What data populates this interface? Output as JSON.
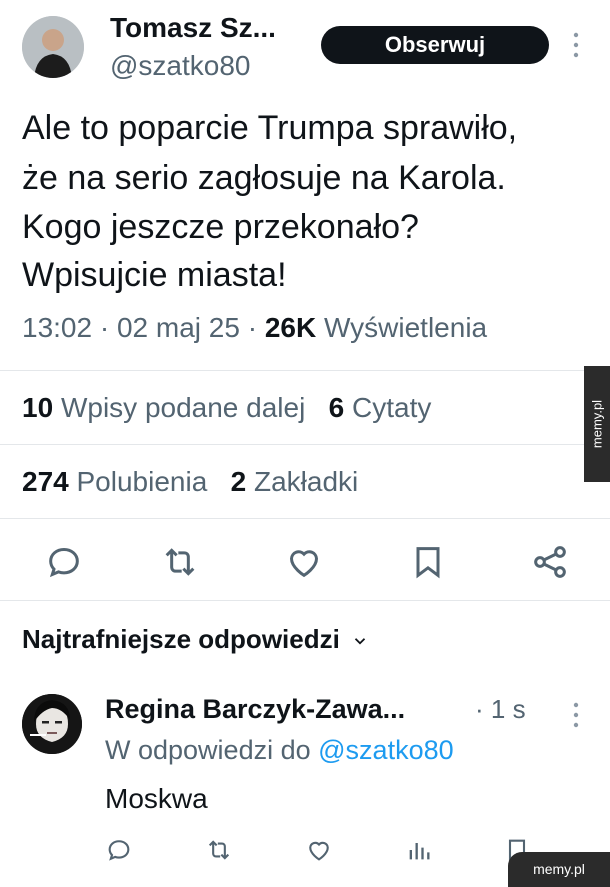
{
  "author": {
    "name": "Tomasz Sz...",
    "handle": "@szatko80",
    "follow_label": "Obserwuj"
  },
  "tweet": {
    "lines": [
      "Ale to poparcie Trumpa sprawiło,",
      "że na serio zagłosuje na Karola.",
      "Kogo jeszcze przekonało?",
      "Wpisujcie miasta!"
    ],
    "time": "13:02",
    "date": "02 maj 25",
    "views_count": "26K",
    "views_label": "Wyświetlenia"
  },
  "stats": {
    "reposts_count": "10",
    "reposts_label": "Wpisy podane dalej",
    "quotes_count": "6",
    "quotes_label": "Cytaty",
    "likes_count": "274",
    "likes_label": "Polubienia",
    "bookmarks_count": "2",
    "bookmarks_label": "Zakładki"
  },
  "replies": {
    "sort_label": "Najtrafniejsze odpowiedzi",
    "items": [
      {
        "name": "Regina Barczyk-Zawa...",
        "time": "1 s",
        "replying_prefix": "W odpowiedzi do",
        "replying_handle": "@szatko80",
        "text": "Moskwa"
      }
    ]
  },
  "watermark": {
    "side": "memy.pl",
    "bottom": "memy.pl"
  },
  "colors": {
    "text": "#0f1419",
    "muted": "#536471",
    "link": "#1d9bf0",
    "button": "#0f1419"
  },
  "icons": [
    "reply-icon",
    "retweet-icon",
    "like-icon",
    "bookmark-icon",
    "share-icon",
    "more-icon",
    "chevron-down-icon",
    "views-icon"
  ]
}
